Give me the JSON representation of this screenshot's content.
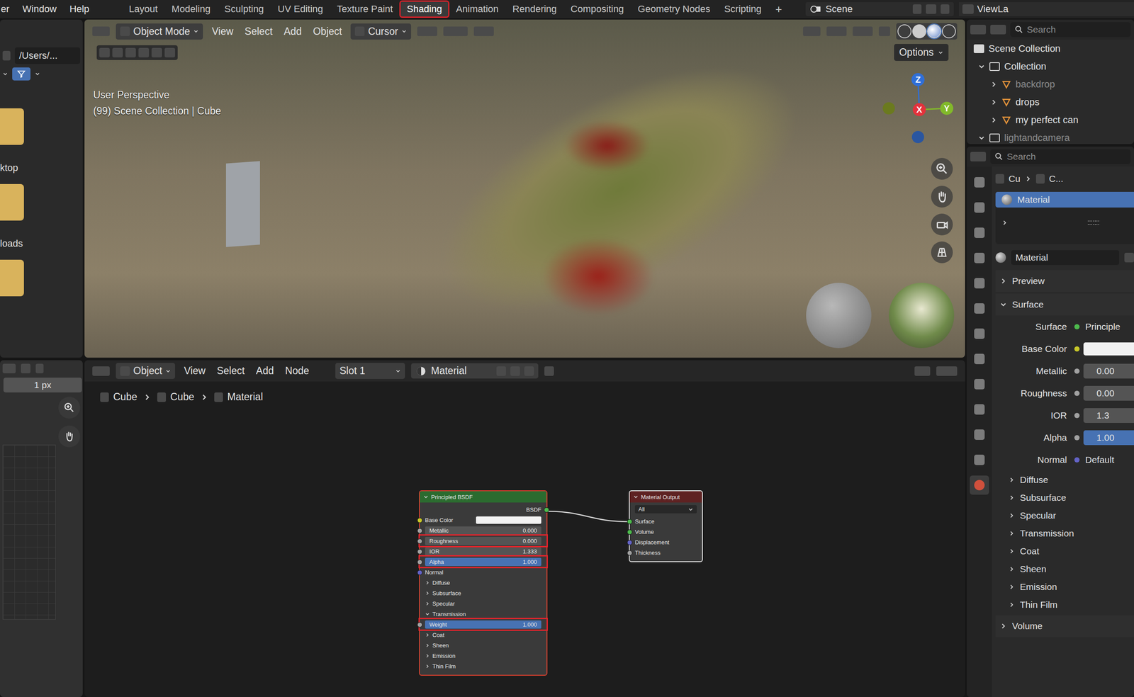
{
  "menu_bar": {
    "menus": [
      "er",
      "Window",
      "Help"
    ],
    "workspaces": [
      {
        "label": "Layout",
        "selected": false
      },
      {
        "label": "Modeling",
        "selected": false
      },
      {
        "label": "Sculpting",
        "selected": false
      },
      {
        "label": "UV Editing",
        "selected": false
      },
      {
        "label": "Texture Paint",
        "selected": false
      },
      {
        "label": "Shading",
        "selected": true
      },
      {
        "label": "Animation",
        "selected": false
      },
      {
        "label": "Rendering",
        "selected": false
      },
      {
        "label": "Compositing",
        "selected": false
      },
      {
        "label": "Geometry Nodes",
        "selected": false
      },
      {
        "label": "Scripting",
        "selected": false
      }
    ],
    "add_workspace": "+",
    "scene": "Scene",
    "view_layer": "ViewLa"
  },
  "file_browser": {
    "path": "/Users/...",
    "folders": [
      {
        "label": "ktop"
      },
      {
        "label": "loads"
      },
      {
        "label": ""
      }
    ]
  },
  "image_editor": {
    "zoom": "1 px"
  },
  "viewport": {
    "mode": "Object Mode",
    "menus": [
      "View",
      "Select",
      "Add",
      "Object"
    ],
    "pivot": "Cursor",
    "options": "Options",
    "overlay_lines": [
      "User Perspective",
      "(99) Scene Collection | Cube"
    ],
    "gizmo_axes": [
      {
        "label": "Z",
        "color": "#2f6fd8"
      },
      {
        "label": "X",
        "color": "#e3323c"
      },
      {
        "label": "Y",
        "color": "#82b92a"
      }
    ]
  },
  "node_editor": {
    "mode": "Object",
    "menus": [
      "View",
      "Select",
      "Add",
      "Node"
    ],
    "slot": "Slot 1",
    "material": "Material",
    "breadcrumb": [
      "Cube",
      "Cube",
      "Material"
    ],
    "principled": {
      "title": "Principled BSDF",
      "rows": [
        {
          "kind": "output",
          "label": "BSDF",
          "color": "#4dbb4d",
          "highlighted": false,
          "active": false
        },
        {
          "kind": "color",
          "label": "Base Color",
          "color": "#c7c729",
          "swatch": "#f2f2f2",
          "highlighted": false,
          "active": false
        },
        {
          "kind": "field",
          "label": "Metallic",
          "value": "0.000",
          "color": "#a1a1a1",
          "highlighted": false,
          "active": false
        },
        {
          "kind": "field",
          "label": "Roughness",
          "value": "0.000",
          "color": "#a1a1a1",
          "highlighted": true,
          "active": false
        },
        {
          "kind": "field",
          "label": "IOR",
          "value": "1.333",
          "color": "#a1a1a1",
          "highlighted": false,
          "active": false
        },
        {
          "kind": "field",
          "label": "Alpha",
          "value": "1.000",
          "color": "#a1a1a1",
          "highlighted": true,
          "active": true
        },
        {
          "kind": "socket",
          "label": "Normal",
          "color": "#6363c7",
          "highlighted": false,
          "active": false
        },
        {
          "kind": "panel",
          "label": "Diffuse",
          "expanded": false,
          "highlighted": false,
          "active": false
        },
        {
          "kind": "panel",
          "label": "Subsurface",
          "expanded": false,
          "highlighted": false,
          "active": false
        },
        {
          "kind": "panel",
          "label": "Specular",
          "expanded": false,
          "highlighted": false,
          "active": false
        },
        {
          "kind": "panel",
          "label": "Transmission",
          "expanded": true,
          "highlighted": false,
          "active": false
        },
        {
          "kind": "field",
          "label": "Weight",
          "value": "1.000",
          "color": "#a1a1a1",
          "highlighted": true,
          "active": true
        },
        {
          "kind": "panel",
          "label": "Coat",
          "expanded": false,
          "highlighted": false,
          "active": false
        },
        {
          "kind": "panel",
          "label": "Sheen",
          "expanded": false,
          "highlighted": false,
          "active": false
        },
        {
          "kind": "panel",
          "label": "Emission",
          "expanded": false,
          "highlighted": false,
          "active": false
        },
        {
          "kind": "panel",
          "label": "Thin Film",
          "expanded": false,
          "highlighted": false,
          "active": false
        }
      ]
    },
    "output": {
      "title": "Material Output",
      "target": "All",
      "inputs": [
        {
          "label": "Surface",
          "color": "#4dbb4d",
          "linked": true
        },
        {
          "label": "Volume",
          "color": "#4dbb4d",
          "linked": false
        },
        {
          "label": "Displacement",
          "color": "#6363c7",
          "linked": false
        },
        {
          "label": "Thickness",
          "color": "#a1a1a1",
          "linked": false
        }
      ]
    }
  },
  "outliner": {
    "search": "Search",
    "root": "Scene Collection",
    "items": [
      {
        "label": "Collection",
        "depth": 1,
        "kind": "collection",
        "expanded": true,
        "greyed": false
      },
      {
        "label": "backdrop",
        "depth": 2,
        "kind": "object",
        "expanded": false,
        "greyed": true
      },
      {
        "label": "drops",
        "depth": 2,
        "kind": "object",
        "expanded": false,
        "greyed": false
      },
      {
        "label": "my perfect can",
        "depth": 2,
        "kind": "object",
        "expanded": false,
        "greyed": false
      },
      {
        "label": "lightandcamera",
        "depth": 1,
        "kind": "collection",
        "expanded": true,
        "greyed": true
      }
    ]
  },
  "properties": {
    "search": "Search",
    "tabs": [
      {
        "selected": false
      },
      {
        "selected": false
      },
      {
        "selected": false
      },
      {
        "selected": false
      },
      {
        "selected": false
      },
      {
        "selected": false
      },
      {
        "selected": false
      },
      {
        "selected": false
      },
      {
        "selected": false
      },
      {
        "selected": false
      },
      {
        "selected": false
      },
      {
        "selected": false
      },
      {
        "selected": true
      }
    ],
    "breadcrumb": [
      "Cu",
      "C..."
    ],
    "slots": [
      {
        "label": "Material",
        "selected": true
      }
    ],
    "material": "Material",
    "sections": [
      {
        "label": "Preview",
        "expanded": false,
        "fields": [],
        "subpanels": []
      },
      {
        "label": "Surface",
        "expanded": true,
        "fields": [
          {
            "label": "Surface",
            "kind": "shader",
            "value": "Principle",
            "color": "#4dbb4d",
            "active": false
          },
          {
            "label": "Base Color",
            "kind": "color",
            "value": "",
            "swatch": "#f2f2f2",
            "color": "#c7c729",
            "active": false
          },
          {
            "label": "Metallic",
            "kind": "field",
            "value": "0.00",
            "color": "#a1a1a1",
            "active": false
          },
          {
            "label": "Roughness",
            "kind": "field",
            "value": "0.00",
            "color": "#a1a1a1",
            "active": false
          },
          {
            "label": "IOR",
            "kind": "field",
            "value": "1.3",
            "color": "#a1a1a1",
            "active": false
          },
          {
            "label": "Alpha",
            "kind": "field",
            "value": "1.00",
            "color": "#a1a1a1",
            "active": true
          },
          {
            "label": "Normal",
            "kind": "link",
            "value": "Default",
            "color": "#6363c7",
            "active": false
          }
        ],
        "subpanels": [
          {
            "label": "Diffuse",
            "expanded": false
          },
          {
            "label": "Subsurface",
            "expanded": false
          },
          {
            "label": "Specular",
            "expanded": false
          },
          {
            "label": "Transmission",
            "expanded": false
          },
          {
            "label": "Coat",
            "expanded": false
          },
          {
            "label": "Sheen",
            "expanded": false
          },
          {
            "label": "Emission",
            "expanded": false
          },
          {
            "label": "Thin Film",
            "expanded": false
          }
        ]
      },
      {
        "label": "Volume",
        "expanded": false,
        "fields": [],
        "subpanels": []
      }
    ]
  }
}
